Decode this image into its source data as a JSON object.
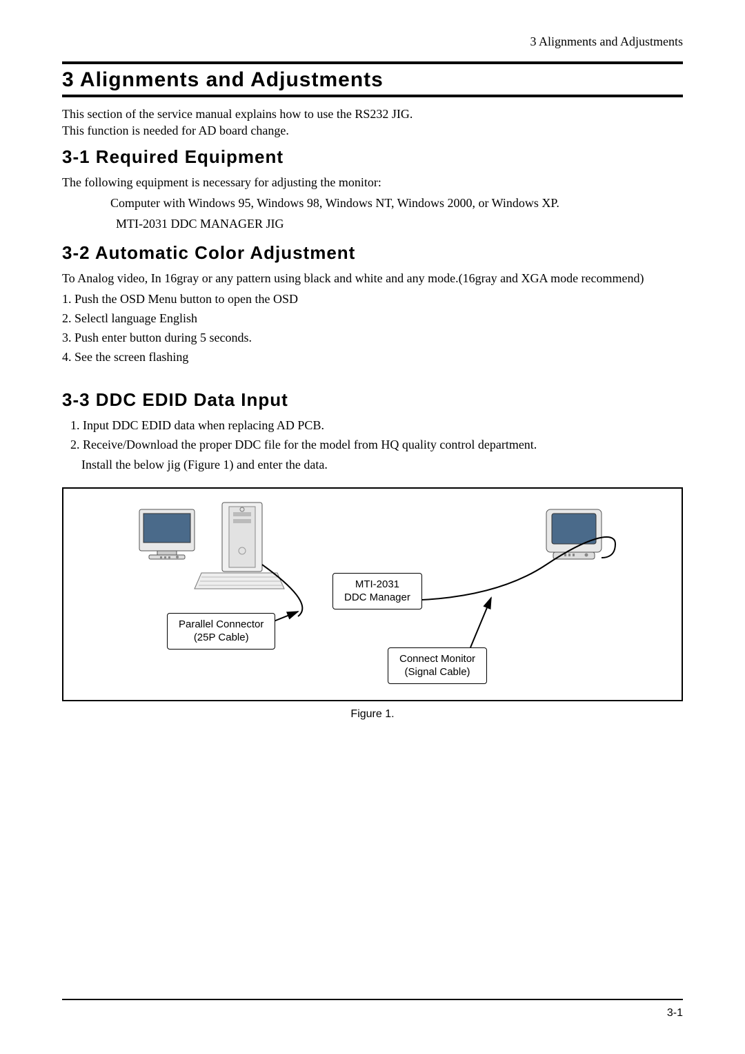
{
  "header": {
    "running": "3 Alignments and Adjustments"
  },
  "chapter": {
    "title": "3 Alignments and Adjustments"
  },
  "intro": {
    "line1": "This section of the service manual explains how to use the RS232 JIG.",
    "line2": "This function is needed for AD board change."
  },
  "sec31": {
    "title": "3-1 Required Equipment",
    "lead": "The following equipment is necessary for adjusting the monitor:",
    "item1": "Computer with Windows 95, Windows 98, Windows NT, Windows 2000, or Windows XP.",
    "item2": "MTI-2031 DDC MANAGER JIG"
  },
  "sec32": {
    "title": "3-2 Automatic Color Adjustment",
    "lead": "To Analog video, In 16gray or any pattern using black and white and any mode.(16gray and XGA mode recommend)",
    "s1": "1. Push the OSD Menu button to open the OSD",
    "s2": "2. Selectl language English",
    "s3": "3. Push enter button during 5 seconds.",
    "s4": "4. See the screen flashing"
  },
  "sec33": {
    "title": "3-3 DDC EDID Data Input",
    "s1": "1. Input DDC EDID data when replacing AD PCB.",
    "s2": "2. Receive/Download the proper DDC file for the model from HQ quality control department.",
    "s2b": "Install the below jig (Figure 1) and enter the data."
  },
  "figure": {
    "label_parallel_l1": "Parallel Connector",
    "label_parallel_l2": "(25P Cable)",
    "label_mti_l1": "MTI-2031",
    "label_mti_l2": "DDC Manager",
    "label_connect_l1": "Connect Monitor",
    "label_connect_l2": "(Signal Cable)",
    "caption": "Figure 1."
  },
  "footer": {
    "pagenum": "3-1"
  }
}
